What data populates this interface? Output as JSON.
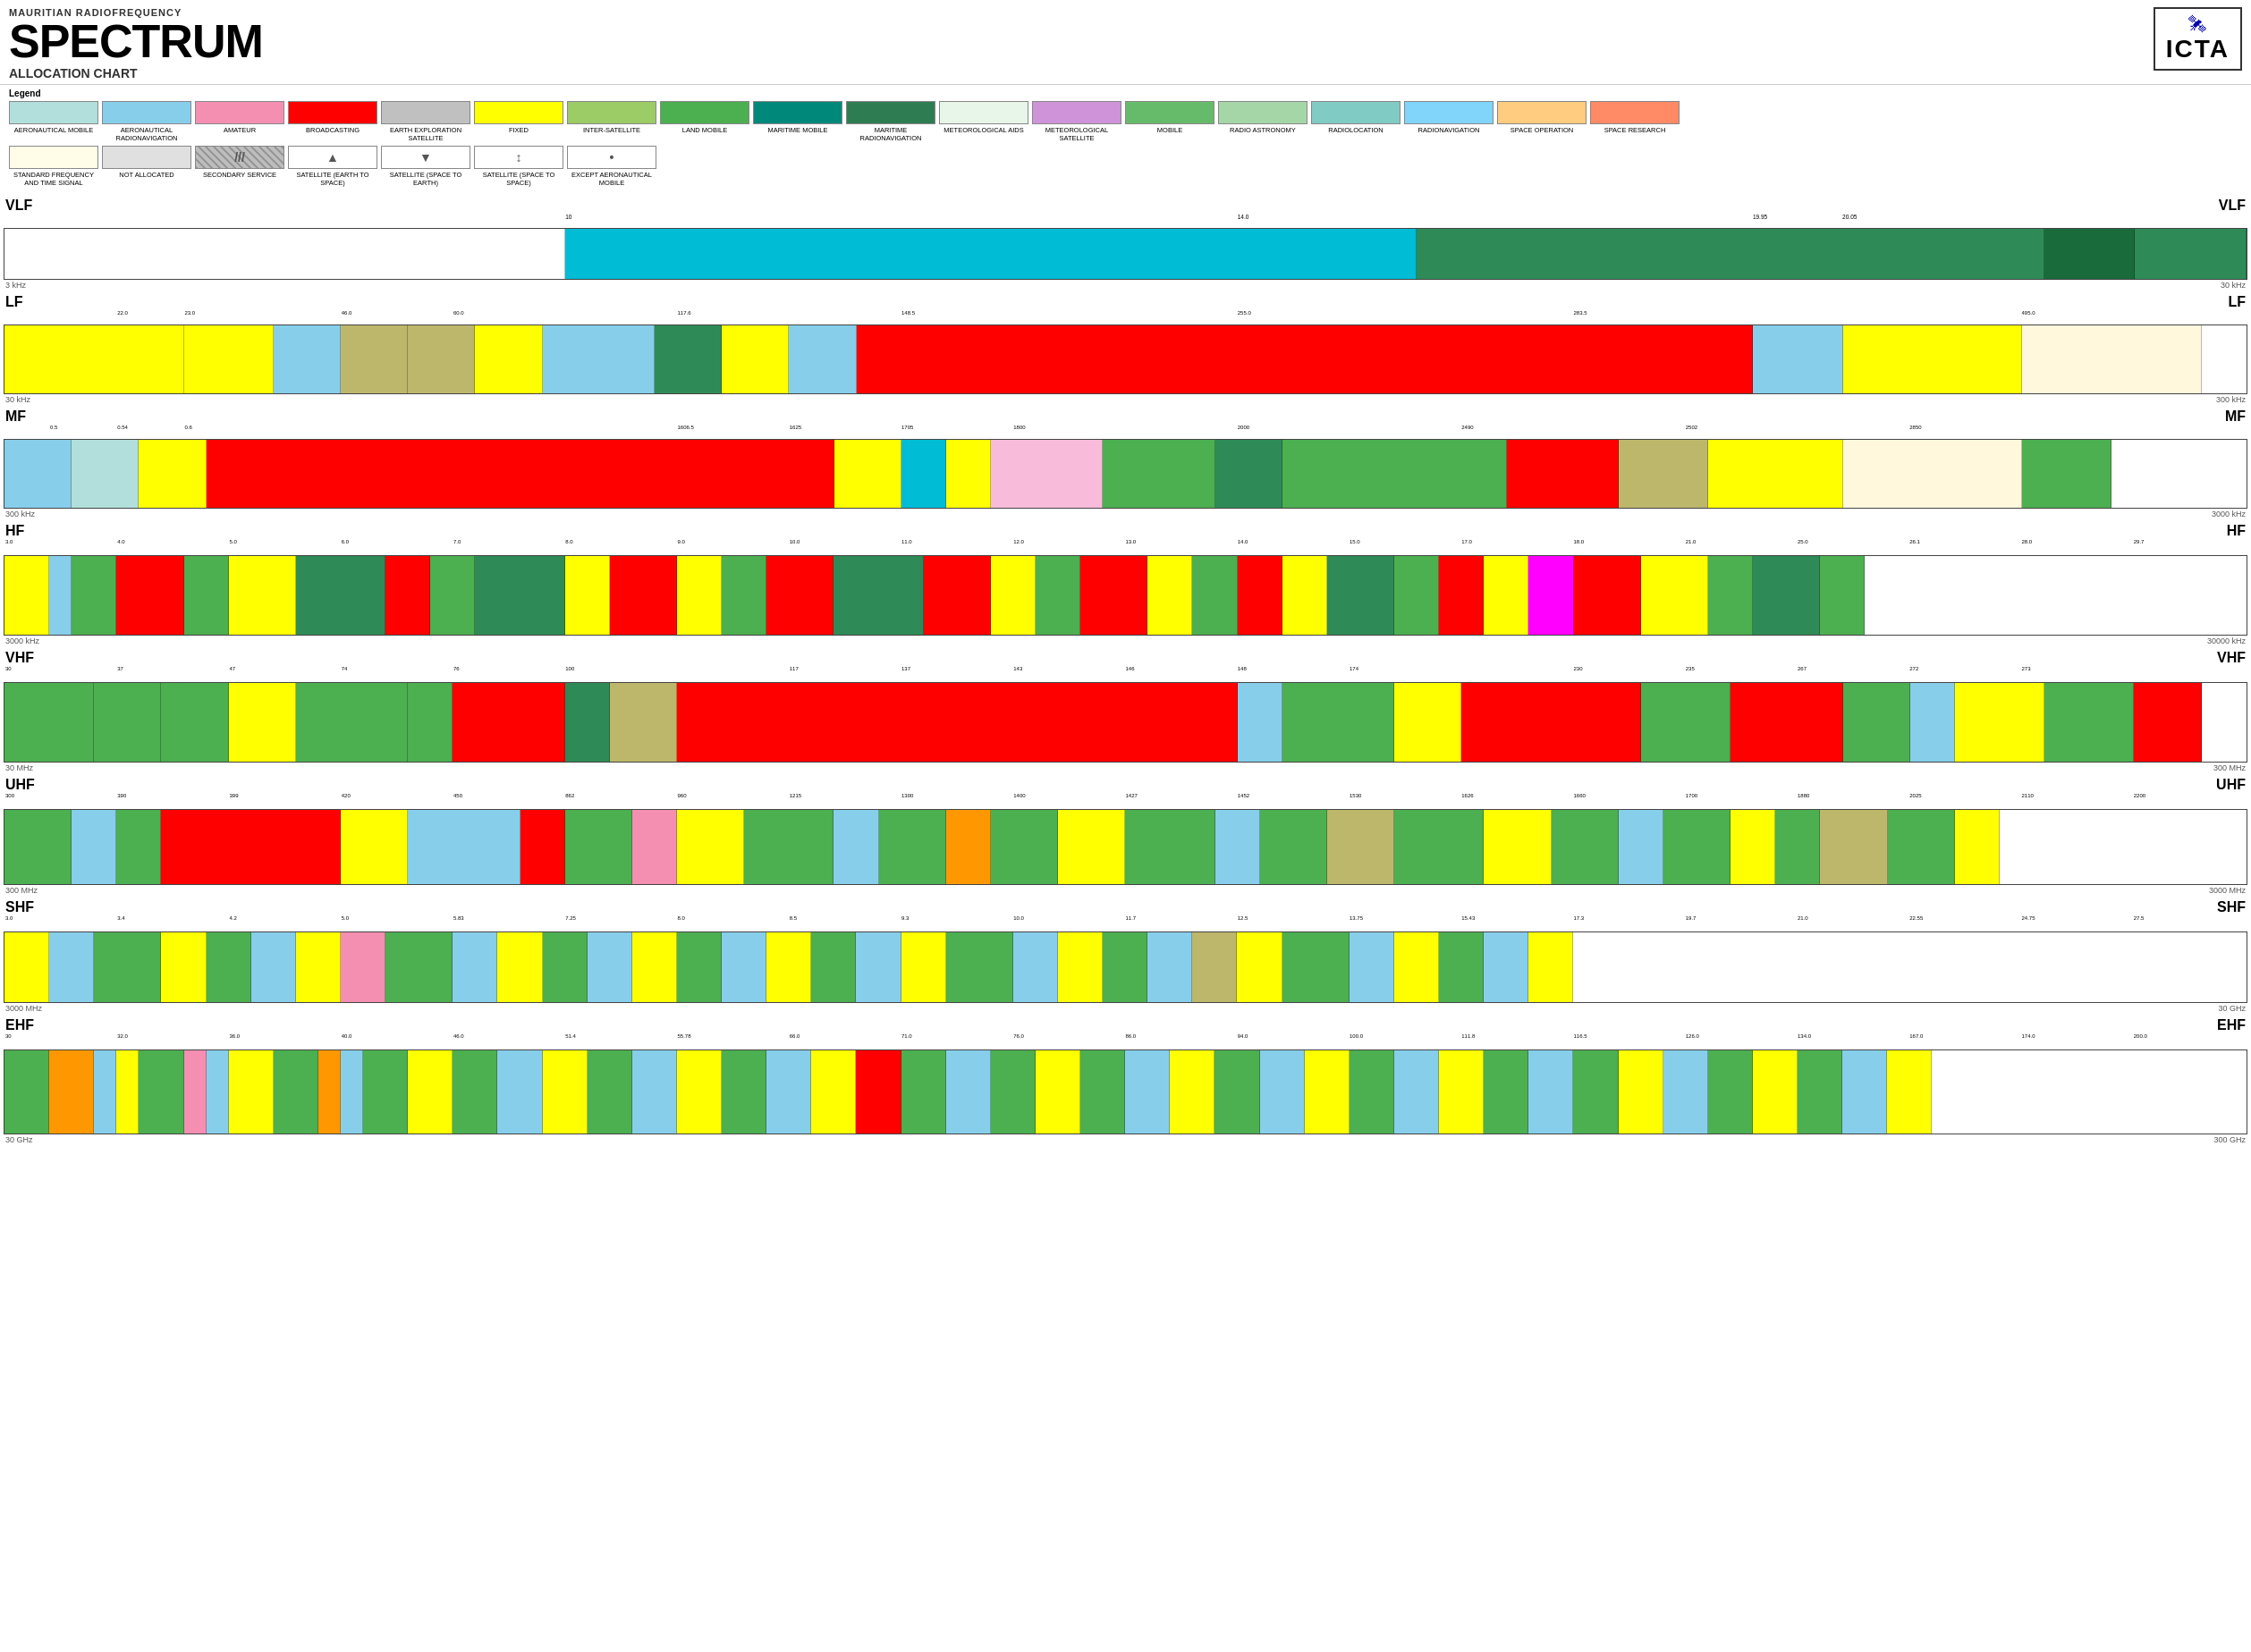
{
  "header": {
    "subtitle": "MAURITIAN RADIOFREQUENCY",
    "title": "SPECTRUM",
    "alloc": "ALLOCATION CHART",
    "logo": "ICTA"
  },
  "legend": {
    "label": "Legend",
    "items": [
      {
        "label": "AERONAUTICAL MOBILE",
        "color": "#b2dfdb",
        "width": 100
      },
      {
        "label": "AERONAUTICAL RADIONAVIGATION",
        "color": "#87ceeb",
        "width": 100
      },
      {
        "label": "AMATEUR",
        "color": "#f48fb1",
        "width": 100
      },
      {
        "label": "BROADCASTING",
        "color": "#ff0000",
        "width": 100
      },
      {
        "label": "EARTH EXPLORATION SATELLITE",
        "color": "#c0c0c0",
        "width": 100
      },
      {
        "label": "FIXED",
        "color": "#ffff00",
        "width": 100
      },
      {
        "label": "INTER-SATELLITE",
        "color": "#9ccc65",
        "width": 100
      },
      {
        "label": "LAND MOBILE",
        "color": "#4caf50",
        "width": 100
      },
      {
        "label": "MARITIME MOBILE",
        "color": "#00897b",
        "width": 100
      },
      {
        "label": "MARITIME RADIONAVIGATION",
        "color": "#2e7d52",
        "width": 100
      },
      {
        "label": "METEOROLOGICAL AIDS",
        "color": "#e8f5e9",
        "width": 100
      },
      {
        "label": "METEOROLOGICAL SATELLITE",
        "color": "#ce93d8",
        "width": 100
      },
      {
        "label": "MOBILE",
        "color": "#66bb6a",
        "width": 100
      },
      {
        "label": "RADIO ASTRONOMY",
        "color": "#a5d6a7",
        "width": 100
      },
      {
        "label": "RADIOLOCATION",
        "color": "#80cbc4",
        "width": 100
      },
      {
        "label": "RADIONAVIGATION",
        "color": "#81d4fa",
        "width": 100
      },
      {
        "label": "SPACE OPERATION",
        "color": "#ffcc80",
        "width": 100
      },
      {
        "label": "SPACE RESEARCH",
        "color": "#ff8a65",
        "width": 100
      }
    ],
    "items2": [
      {
        "label": "STANDARD FREQUENCY AND TIME SIGNAL",
        "color": "#fffde7",
        "symbol": "",
        "width": 100
      },
      {
        "label": "NOT ALLOCATED",
        "color": "#e0e0e0",
        "symbol": "",
        "width": 100
      },
      {
        "label": "SECONDARY SERVICE",
        "color": "#bdbdbd",
        "symbol": "///",
        "hatched": true,
        "width": 100
      },
      {
        "label": "SATELLITE (EARTH TO SPACE)",
        "color": "#fff",
        "symbol": "▲",
        "width": 100
      },
      {
        "label": "SATELLITE (SPACE TO EARTH)",
        "color": "#fff",
        "symbol": "▼",
        "width": 100
      },
      {
        "label": "SATELLITE (SPACE TO SPACE)",
        "color": "#fff",
        "symbol": "↕",
        "width": 100
      },
      {
        "label": "EXCEPT AERONAUTICAL MOBILE",
        "color": "#fff",
        "symbol": "•",
        "width": 100
      }
    ]
  },
  "bands": {
    "vlf": {
      "name": "VLF",
      "freq_start": "3 kHz",
      "freq_end": "30 kHz",
      "ticks": [
        "10",
        "14.0",
        "19.95",
        "20.05"
      ],
      "segments": [
        {
          "color": "#ffffff",
          "pct": 25
        },
        {
          "color": "#00bcd4",
          "pct": 38
        },
        {
          "color": "#2e8b57",
          "pct": 28
        },
        {
          "color": "#1a6b3c",
          "pct": 4
        },
        {
          "color": "#2e8b57",
          "pct": 5
        }
      ]
    },
    "lf": {
      "name": "LF",
      "freq_start": "30 kHz",
      "freq_end": "300 kHz",
      "segments": [
        {
          "color": "#ffff00",
          "pct": 8
        },
        {
          "color": "#ffff00",
          "pct": 4
        },
        {
          "color": "#87ceeb",
          "pct": 3
        },
        {
          "color": "#bdb76b",
          "pct": 3
        },
        {
          "color": "#bdb76b",
          "pct": 3
        },
        {
          "color": "#ffff00",
          "pct": 3
        },
        {
          "color": "#87ceeb",
          "pct": 5
        },
        {
          "color": "#2e8b57",
          "pct": 3
        },
        {
          "color": "#ffff00",
          "pct": 3
        },
        {
          "color": "#87ceeb",
          "pct": 3
        },
        {
          "color": "#ff0000",
          "pct": 40
        },
        {
          "color": "#87ceeb",
          "pct": 4
        },
        {
          "color": "#ffff00",
          "pct": 8
        },
        {
          "color": "#fff8dc",
          "pct": 8
        }
      ]
    },
    "mf": {
      "name": "MF",
      "freq_start": "300 kHz",
      "freq_end": "3000 kHz",
      "segments": [
        {
          "color": "#87ceeb",
          "pct": 3
        },
        {
          "color": "#b2dfdb",
          "pct": 3
        },
        {
          "color": "#ffff00",
          "pct": 3
        },
        {
          "color": "#ff0000",
          "pct": 28
        },
        {
          "color": "#ffff00",
          "pct": 3
        },
        {
          "color": "#00bcd4",
          "pct": 2
        },
        {
          "color": "#ffff00",
          "pct": 2
        },
        {
          "color": "#f8bbd9",
          "pct": 5
        },
        {
          "color": "#4caf50",
          "pct": 5
        },
        {
          "color": "#2e8b57",
          "pct": 3
        },
        {
          "color": "#4caf50",
          "pct": 10
        },
        {
          "color": "#ff0000",
          "pct": 5
        },
        {
          "color": "#bdb76b",
          "pct": 4
        },
        {
          "color": "#ffff00",
          "pct": 6
        },
        {
          "color": "#fff8dc",
          "pct": 8
        },
        {
          "color": "#4caf50",
          "pct": 4
        }
      ]
    },
    "hf": {
      "name": "HF",
      "freq_start": "3000 kHz",
      "freq_end": "30000 kHz",
      "segments": [
        {
          "color": "#ffff00",
          "pct": 2
        },
        {
          "color": "#87ceeb",
          "pct": 1
        },
        {
          "color": "#4caf50",
          "pct": 2
        },
        {
          "color": "#ff0000",
          "pct": 3
        },
        {
          "color": "#4caf50",
          "pct": 2
        },
        {
          "color": "#ffff00",
          "pct": 3
        },
        {
          "color": "#2e8b57",
          "pct": 4
        },
        {
          "color": "#ff0000",
          "pct": 2
        },
        {
          "color": "#4caf50",
          "pct": 2
        },
        {
          "color": "#2e8b57",
          "pct": 4
        },
        {
          "color": "#ffff00",
          "pct": 2
        },
        {
          "color": "#ff0000",
          "pct": 3
        },
        {
          "color": "#ffff00",
          "pct": 2
        },
        {
          "color": "#4caf50",
          "pct": 2
        },
        {
          "color": "#ff0000",
          "pct": 3
        },
        {
          "color": "#2e8b57",
          "pct": 4
        },
        {
          "color": "#ff0000",
          "pct": 3
        },
        {
          "color": "#ffff00",
          "pct": 2
        },
        {
          "color": "#4caf50",
          "pct": 2
        },
        {
          "color": "#ff0000",
          "pct": 3
        },
        {
          "color": "#ffff00",
          "pct": 2
        },
        {
          "color": "#4caf50",
          "pct": 2
        },
        {
          "color": "#ff0000",
          "pct": 2
        },
        {
          "color": "#ffff00",
          "pct": 2
        },
        {
          "color": "#2e8b57",
          "pct": 3
        },
        {
          "color": "#4caf50",
          "pct": 2
        },
        {
          "color": "#ff0000",
          "pct": 2
        },
        {
          "color": "#ffff00",
          "pct": 2
        },
        {
          "color": "#ff00ff",
          "pct": 2
        },
        {
          "color": "#ff0000",
          "pct": 3
        },
        {
          "color": "#ffff00",
          "pct": 3
        },
        {
          "color": "#4caf50",
          "pct": 2
        },
        {
          "color": "#2e8b57",
          "pct": 3
        },
        {
          "color": "#4caf50",
          "pct": 2
        }
      ]
    },
    "vhf": {
      "name": "VHF",
      "freq_start": "30 MHz",
      "freq_end": "300 MHz",
      "segments": [
        {
          "color": "#4caf50",
          "pct": 4
        },
        {
          "color": "#4caf50",
          "pct": 3
        },
        {
          "color": "#4caf50",
          "pct": 3
        },
        {
          "color": "#ffff00",
          "pct": 3
        },
        {
          "color": "#4caf50",
          "pct": 5
        },
        {
          "color": "#4caf50",
          "pct": 2
        },
        {
          "color": "#ff0000",
          "pct": 5
        },
        {
          "color": "#2e8b57",
          "pct": 2
        },
        {
          "color": "#bdb76b",
          "pct": 3
        },
        {
          "color": "#ff0000",
          "pct": 25
        },
        {
          "color": "#87ceeb",
          "pct": 2
        },
        {
          "color": "#4caf50",
          "pct": 5
        },
        {
          "color": "#ffff00",
          "pct": 3
        },
        {
          "color": "#ff0000",
          "pct": 8
        },
        {
          "color": "#4caf50",
          "pct": 4
        },
        {
          "color": "#ff0000",
          "pct": 5
        },
        {
          "color": "#4caf50",
          "pct": 3
        },
        {
          "color": "#87ceeb",
          "pct": 2
        },
        {
          "color": "#ffff00",
          "pct": 4
        },
        {
          "color": "#4caf50",
          "pct": 4
        },
        {
          "color": "#ff0000",
          "pct": 3
        }
      ]
    },
    "uhf": {
      "name": "UHF",
      "freq_start": "300 MHz",
      "freq_end": "3000 MHz",
      "segments": [
        {
          "color": "#4caf50",
          "pct": 3
        },
        {
          "color": "#87ceeb",
          "pct": 2
        },
        {
          "color": "#4caf50",
          "pct": 2
        },
        {
          "color": "#ff0000",
          "pct": 8
        },
        {
          "color": "#ffff00",
          "pct": 3
        },
        {
          "color": "#87ceeb",
          "pct": 5
        },
        {
          "color": "#ff0000",
          "pct": 2
        },
        {
          "color": "#4caf50",
          "pct": 3
        },
        {
          "color": "#f48fb1",
          "pct": 2
        },
        {
          "color": "#ffff00",
          "pct": 3
        },
        {
          "color": "#4caf50",
          "pct": 4
        },
        {
          "color": "#87ceeb",
          "pct": 2
        },
        {
          "color": "#4caf50",
          "pct": 3
        },
        {
          "color": "#ff9800",
          "pct": 2
        },
        {
          "color": "#4caf50",
          "pct": 3
        },
        {
          "color": "#ffff00",
          "pct": 3
        },
        {
          "color": "#4caf50",
          "pct": 4
        },
        {
          "color": "#87ceeb",
          "pct": 2
        },
        {
          "color": "#4caf50",
          "pct": 3
        },
        {
          "color": "#bdb76b",
          "pct": 3
        },
        {
          "color": "#4caf50",
          "pct": 4
        },
        {
          "color": "#ffff00",
          "pct": 3
        },
        {
          "color": "#4caf50",
          "pct": 3
        },
        {
          "color": "#87ceeb",
          "pct": 2
        },
        {
          "color": "#4caf50",
          "pct": 3
        },
        {
          "color": "#ffff00",
          "pct": 2
        },
        {
          "color": "#4caf50",
          "pct": 2
        },
        {
          "color": "#bdb76b",
          "pct": 3
        },
        {
          "color": "#4caf50",
          "pct": 3
        },
        {
          "color": "#ffff00",
          "pct": 2
        }
      ]
    },
    "shf": {
      "name": "SHF",
      "freq_start": "3000 MHz",
      "freq_end": "30 GHz",
      "segments": [
        {
          "color": "#ffff00",
          "pct": 2
        },
        {
          "color": "#87ceeb",
          "pct": 2
        },
        {
          "color": "#4caf50",
          "pct": 3
        },
        {
          "color": "#ffff00",
          "pct": 2
        },
        {
          "color": "#4caf50",
          "pct": 2
        },
        {
          "color": "#87ceeb",
          "pct": 2
        },
        {
          "color": "#ffff00",
          "pct": 2
        },
        {
          "color": "#f48fb1",
          "pct": 2
        },
        {
          "color": "#4caf50",
          "pct": 3
        },
        {
          "color": "#87ceeb",
          "pct": 2
        },
        {
          "color": "#ffff00",
          "pct": 2
        },
        {
          "color": "#4caf50",
          "pct": 2
        },
        {
          "color": "#87ceeb",
          "pct": 2
        },
        {
          "color": "#ffff00",
          "pct": 2
        },
        {
          "color": "#4caf50",
          "pct": 2
        },
        {
          "color": "#87ceeb",
          "pct": 2
        },
        {
          "color": "#ffff00",
          "pct": 2
        },
        {
          "color": "#4caf50",
          "pct": 2
        },
        {
          "color": "#87ceeb",
          "pct": 2
        },
        {
          "color": "#ffff00",
          "pct": 2
        },
        {
          "color": "#4caf50",
          "pct": 3
        },
        {
          "color": "#87ceeb",
          "pct": 2
        },
        {
          "color": "#ffff00",
          "pct": 2
        },
        {
          "color": "#4caf50",
          "pct": 2
        },
        {
          "color": "#87ceeb",
          "pct": 2
        },
        {
          "color": "#bdb76b",
          "pct": 2
        },
        {
          "color": "#ffff00",
          "pct": 2
        },
        {
          "color": "#4caf50",
          "pct": 3
        },
        {
          "color": "#87ceeb",
          "pct": 2
        },
        {
          "color": "#ffff00",
          "pct": 2
        },
        {
          "color": "#4caf50",
          "pct": 2
        },
        {
          "color": "#87ceeb",
          "pct": 2
        },
        {
          "color": "#ffff00",
          "pct": 2
        }
      ]
    },
    "ehf": {
      "name": "EHF",
      "freq_start": "30 GHz",
      "freq_end": "300 GHz",
      "segments": [
        {
          "color": "#4caf50",
          "pct": 2
        },
        {
          "color": "#ff9800",
          "pct": 2
        },
        {
          "color": "#87ceeb",
          "pct": 1
        },
        {
          "color": "#ffff00",
          "pct": 1
        },
        {
          "color": "#4caf50",
          "pct": 2
        },
        {
          "color": "#f48fb1",
          "pct": 1
        },
        {
          "color": "#87ceeb",
          "pct": 1
        },
        {
          "color": "#ffff00",
          "pct": 2
        },
        {
          "color": "#4caf50",
          "pct": 2
        },
        {
          "color": "#ff9800",
          "pct": 1
        },
        {
          "color": "#87ceeb",
          "pct": 1
        },
        {
          "color": "#4caf50",
          "pct": 2
        },
        {
          "color": "#ffff00",
          "pct": 2
        },
        {
          "color": "#4caf50",
          "pct": 2
        },
        {
          "color": "#87ceeb",
          "pct": 2
        },
        {
          "color": "#ffff00",
          "pct": 2
        },
        {
          "color": "#4caf50",
          "pct": 2
        },
        {
          "color": "#87ceeb",
          "pct": 2
        },
        {
          "color": "#ffff00",
          "pct": 2
        },
        {
          "color": "#4caf50",
          "pct": 2
        },
        {
          "color": "#87ceeb",
          "pct": 2
        },
        {
          "color": "#ffff00",
          "pct": 2
        },
        {
          "color": "#ff0000",
          "pct": 2
        },
        {
          "color": "#4caf50",
          "pct": 2
        },
        {
          "color": "#87ceeb",
          "pct": 2
        },
        {
          "color": "#4caf50",
          "pct": 2
        },
        {
          "color": "#ffff00",
          "pct": 2
        },
        {
          "color": "#4caf50",
          "pct": 2
        },
        {
          "color": "#87ceeb",
          "pct": 2
        },
        {
          "color": "#ffff00",
          "pct": 2
        },
        {
          "color": "#4caf50",
          "pct": 2
        },
        {
          "color": "#87ceeb",
          "pct": 2
        },
        {
          "color": "#ffff00",
          "pct": 2
        },
        {
          "color": "#4caf50",
          "pct": 2
        },
        {
          "color": "#87ceeb",
          "pct": 2
        },
        {
          "color": "#ffff00",
          "pct": 2
        },
        {
          "color": "#4caf50",
          "pct": 2
        },
        {
          "color": "#87ceeb",
          "pct": 2
        },
        {
          "color": "#4caf50",
          "pct": 2
        },
        {
          "color": "#ffff00",
          "pct": 2
        },
        {
          "color": "#87ceeb",
          "pct": 2
        },
        {
          "color": "#4caf50",
          "pct": 2
        },
        {
          "color": "#ffff00",
          "pct": 2
        },
        {
          "color": "#4caf50",
          "pct": 2
        },
        {
          "color": "#87ceeb",
          "pct": 2
        },
        {
          "color": "#ffff00",
          "pct": 2
        }
      ]
    }
  }
}
